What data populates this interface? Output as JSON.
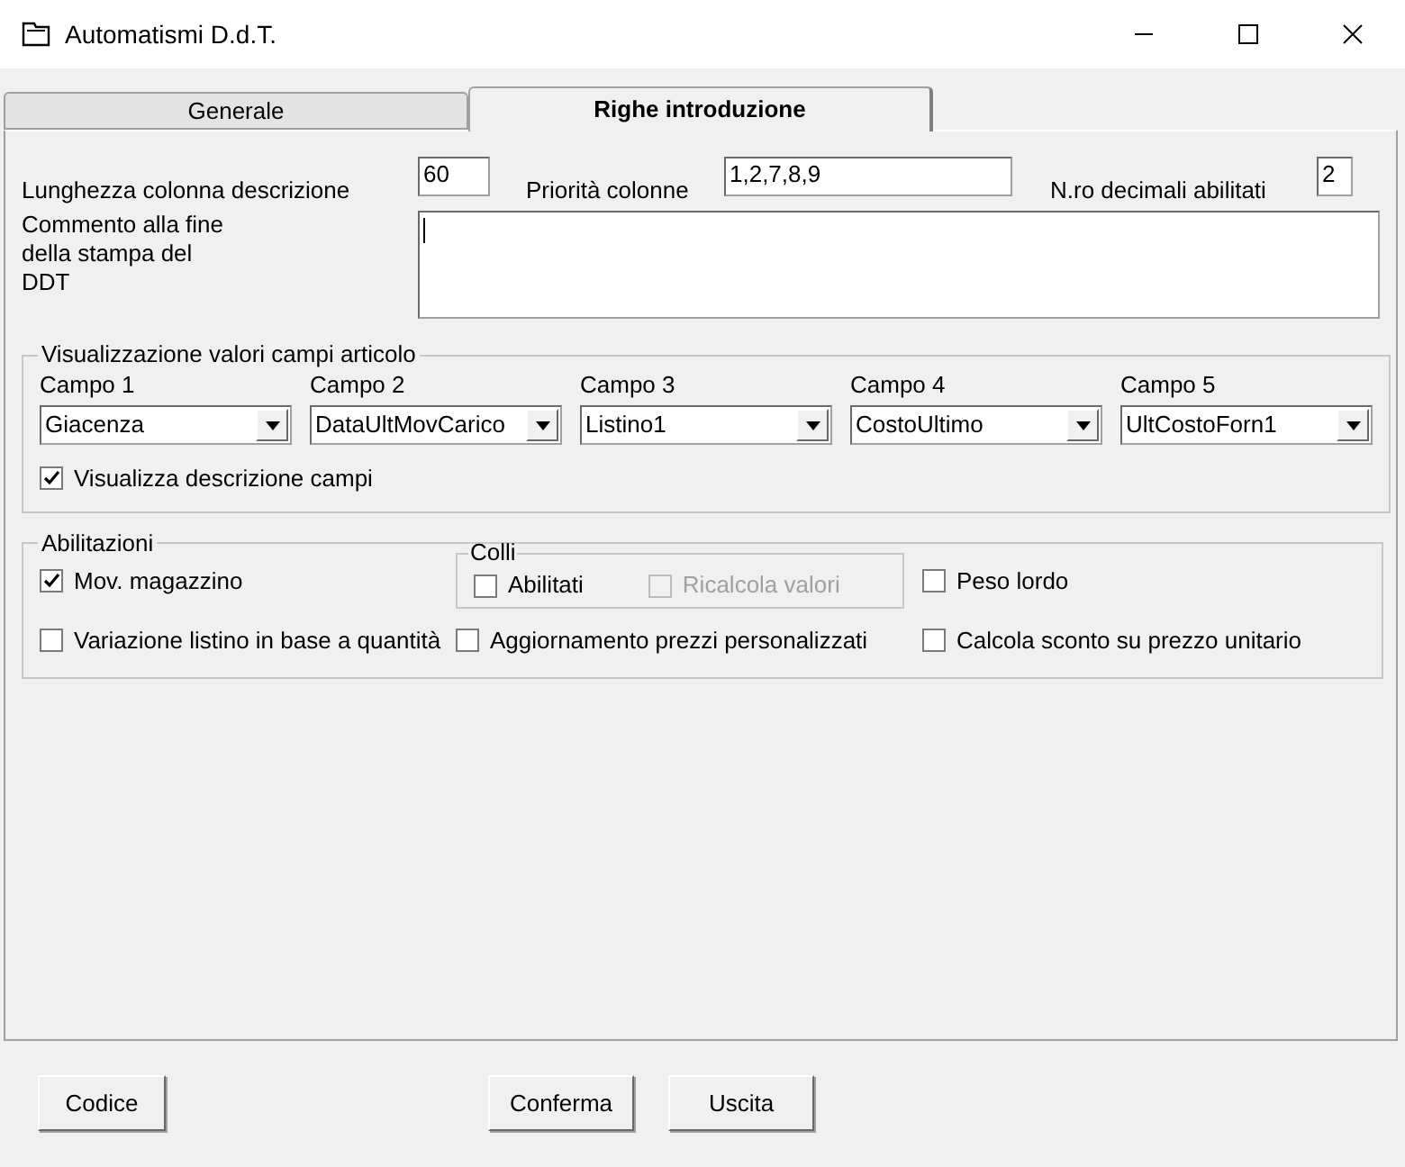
{
  "window": {
    "title": "Automatismi D.d.T."
  },
  "tabs": [
    {
      "label": "Generale",
      "selected": false
    },
    {
      "label": "Righe introduzione",
      "selected": true
    }
  ],
  "top_fields": [
    {
      "label": "Lunghezza colonna descrizione",
      "value": "60"
    },
    {
      "label": "Priorità colonne",
      "value": "1,2,7,8,9"
    },
    {
      "label": "N.ro decimali abilitati",
      "value": "2"
    }
  ],
  "comment": {
    "label": "Commento alla fine della stampa del DDT"
  },
  "article_fields": {
    "title": "Visualizzazione valori campi articolo",
    "fields": [
      {
        "label": "Campo 1",
        "value": "Giacenza"
      },
      {
        "label": "Campo 2",
        "value": "DataUltMovCarico"
      },
      {
        "label": "Campo 3",
        "value": "Listino1"
      },
      {
        "label": "Campo 4",
        "value": "CostoUltimo"
      },
      {
        "label": "Campo 5",
        "value": "UltCostoForn1"
      }
    ],
    "show_descriptions": {
      "label": "Visualizza descrizione campi",
      "checked": true,
      "disabled": false
    }
  },
  "enablements": {
    "title": "Abilitazioni",
    "rows": [
      [
        {
          "kind": "checkbox",
          "label": "Mov. magazzino",
          "checked": true,
          "disabled": false
        },
        {
          "kind": "group",
          "title": "Colli",
          "options": [
            {
              "label": "Abilitati",
              "checked": false,
              "disabled": false
            },
            {
              "label": "Ricalcola valori",
              "checked": false,
              "disabled": true
            }
          ]
        },
        {
          "kind": "checkbox",
          "label": "Peso lordo",
          "checked": false,
          "disabled": false
        }
      ],
      [
        {
          "kind": "checkbox",
          "label": "Variazione listino in base a quantità",
          "checked": false,
          "disabled": false
        },
        {
          "kind": "checkbox",
          "label": "Aggiornamento prezzi personalizzati",
          "checked": false,
          "disabled": false
        },
        {
          "kind": "checkbox",
          "label": "Calcola sconto su prezzo unitario",
          "checked": false,
          "disabled": false
        }
      ]
    ]
  },
  "buttons": [
    {
      "label": "Codice"
    },
    {
      "label": "Conferma"
    },
    {
      "label": "Uscita"
    }
  ]
}
